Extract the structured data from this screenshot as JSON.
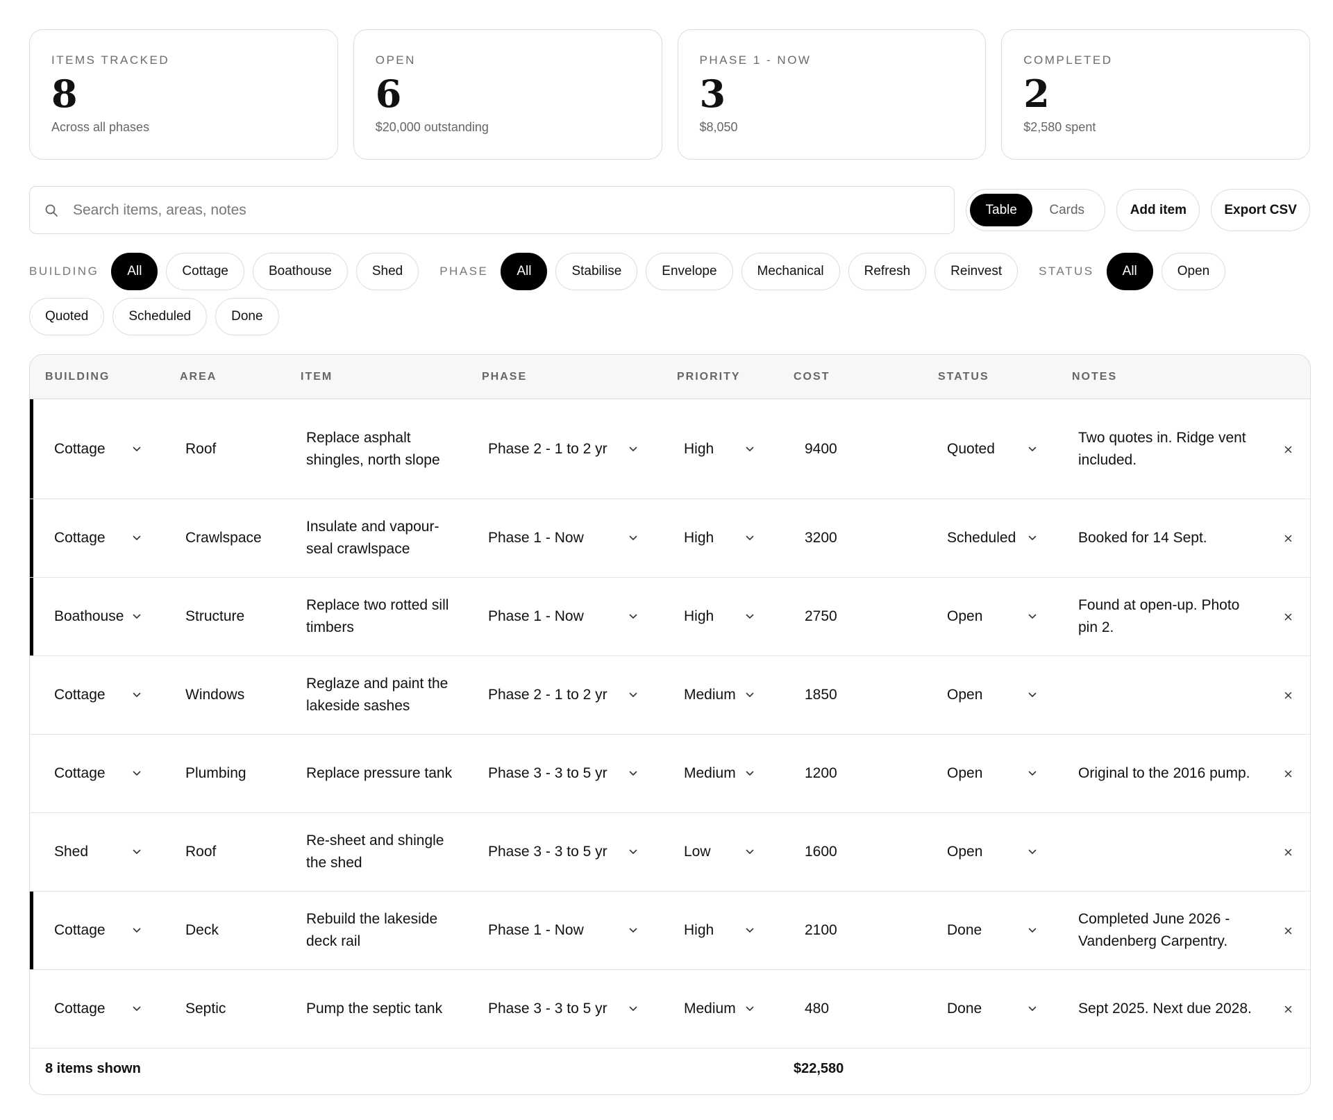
{
  "stats": [
    {
      "label": "ITEMS TRACKED",
      "value": "8",
      "sub": "Across all phases"
    },
    {
      "label": "OPEN",
      "value": "6",
      "sub": "$20,000 outstanding"
    },
    {
      "label": "PHASE 1 - NOW",
      "value": "3",
      "sub": "$8,050"
    },
    {
      "label": "COMPLETED",
      "value": "2",
      "sub": "$2,580 spent"
    }
  ],
  "search": {
    "placeholder": "Search items, areas, notes",
    "value": ""
  },
  "view_toggle": {
    "table_label": "Table",
    "cards_label": "Cards",
    "selected": "Table"
  },
  "actions": {
    "add_label": "Add item",
    "export_label": "Export CSV"
  },
  "filters": {
    "building": {
      "label": "BUILDING",
      "options": [
        "All",
        "Cottage",
        "Boathouse",
        "Shed"
      ],
      "selected": "All"
    },
    "phase": {
      "label": "PHASE",
      "options": [
        "All",
        "Stabilise",
        "Envelope",
        "Mechanical",
        "Refresh",
        "Reinvest"
      ],
      "selected": "All"
    },
    "status": {
      "label": "STATUS",
      "options": [
        "All",
        "Open",
        "Quoted",
        "Scheduled",
        "Done"
      ],
      "selected": "All"
    }
  },
  "table": {
    "columns": [
      "BUILDING",
      "AREA",
      "ITEM",
      "PHASE",
      "PRIORITY",
      "COST",
      "STATUS",
      "NOTES"
    ],
    "rows": [
      {
        "building": "Cottage",
        "area": "Roof",
        "item": "Replace asphalt shingles, north slope",
        "phase": "Phase 2 - 1 to 2 yr",
        "priority": "High",
        "cost": "9400",
        "status": "Quoted",
        "notes": "Two quotes in. Ridge vent included.",
        "flagged": true
      },
      {
        "building": "Cottage",
        "area": "Crawlspace",
        "item": "Insulate and vapour-seal crawlspace",
        "phase": "Phase 1 - Now",
        "priority": "High",
        "cost": "3200",
        "status": "Scheduled",
        "notes": "Booked for 14 Sept.",
        "flagged": true
      },
      {
        "building": "Boathouse",
        "area": "Structure",
        "item": "Replace two rotted sill timbers",
        "phase": "Phase 1 - Now",
        "priority": "High",
        "cost": "2750",
        "status": "Open",
        "notes": "Found at open-up. Photo pin 2.",
        "flagged": true
      },
      {
        "building": "Cottage",
        "area": "Windows",
        "item": "Reglaze and paint the lakeside sashes",
        "phase": "Phase 2 - 1 to 2 yr",
        "priority": "Medium",
        "cost": "1850",
        "status": "Open",
        "notes": "",
        "flagged": false
      },
      {
        "building": "Cottage",
        "area": "Plumbing",
        "item": "Replace pressure tank",
        "phase": "Phase 3 - 3 to 5 yr",
        "priority": "Medium",
        "cost": "1200",
        "status": "Open",
        "notes": "Original to the 2016 pump.",
        "flagged": false
      },
      {
        "building": "Shed",
        "area": "Roof",
        "item": "Re-sheet and shingle the shed",
        "phase": "Phase 3 - 3 to 5 yr",
        "priority": "Low",
        "cost": "1600",
        "status": "Open",
        "notes": "",
        "flagged": false
      },
      {
        "building": "Cottage",
        "area": "Deck",
        "item": "Rebuild the lakeside deck rail",
        "phase": "Phase 1 - Now",
        "priority": "High",
        "cost": "2100",
        "status": "Done",
        "notes": "Completed June 2026 - Vandenberg Carpentry.",
        "flagged": true
      },
      {
        "building": "Cottage",
        "area": "Septic",
        "item": "Pump the septic tank",
        "phase": "Phase 3 - 3 to 5 yr",
        "priority": "Medium",
        "cost": "480",
        "status": "Done",
        "notes": "Sept 2025. Next due 2028.",
        "flagged": false
      }
    ],
    "footer": {
      "count_label": "8 items shown",
      "total": "$22,580"
    }
  },
  "icons": {
    "search": "search-icon",
    "chevron": "chevron-down-icon",
    "remove": "close-icon"
  },
  "colors": {
    "accent": "#000000",
    "border": "#dcdcdc",
    "muted": "#666666"
  }
}
